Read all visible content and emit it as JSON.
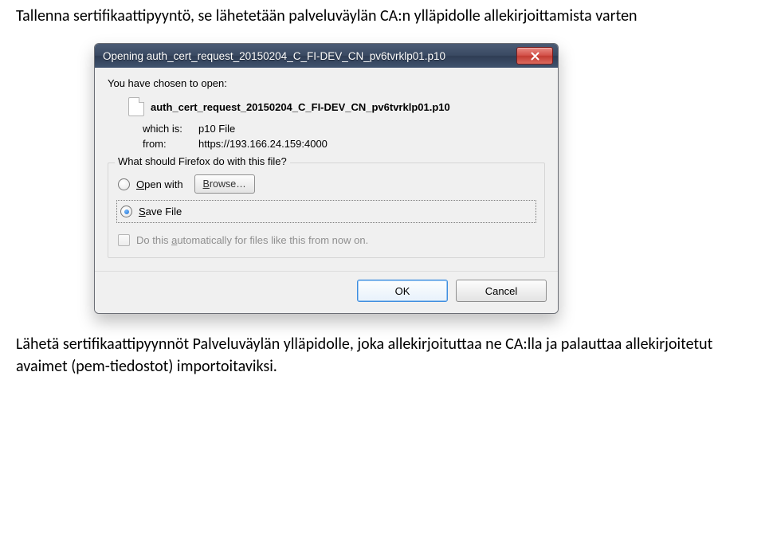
{
  "page": {
    "intro": "Tallenna sertifikaattipyyntö, se lähetetään palveluväylän CA:n ylläpidolle allekirjoittamista varten",
    "outro": "Lähetä sertifikaattipyynnöt Palveluväylän ylläpidolle, joka allekirjoituttaa ne CA:lla ja palauttaa allekirjoitetut avaimet (pem-tiedostot) importoitaviksi."
  },
  "dialog": {
    "title": "Opening auth_cert_request_20150204_C_FI-DEV_CN_pv6tvrklp01.p10",
    "prompt": "You have chosen to open:",
    "file": {
      "name": "auth_cert_request_20150204_C_FI-DEV_CN_pv6tvrklp01.p10",
      "which_is_label": "which is:",
      "which_is_value": "p10 File",
      "from_label": "from:",
      "from_value": "https://193.166.24.159:4000"
    },
    "question": "What should Firefox do with this file?",
    "options": {
      "open_with": {
        "label_pre": "O",
        "label_post": "pen with",
        "selected": false
      },
      "save_file": {
        "label_pre": "S",
        "label_post": "ave File",
        "selected": true
      },
      "browse": {
        "label_pre": "B",
        "label_post": "rowse…"
      }
    },
    "always": {
      "label_pre": "Do this ",
      "u": "a",
      "label_post": "utomatically for files like this from now on.",
      "enabled": false
    },
    "buttons": {
      "ok": "OK",
      "cancel": "Cancel"
    }
  }
}
